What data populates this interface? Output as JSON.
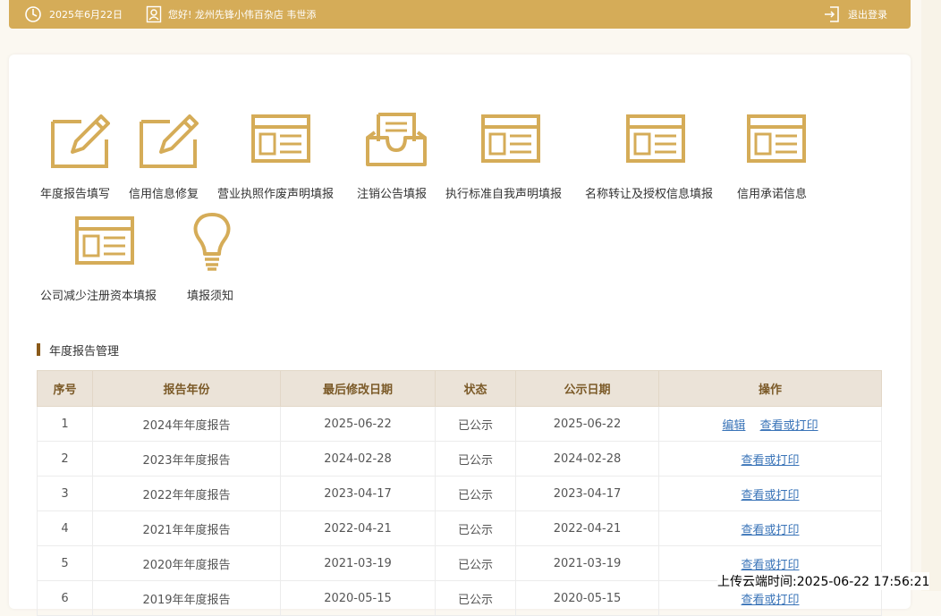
{
  "topbar": {
    "date": "2025年6月22日",
    "greeting": "您好! 龙州先锋小伟百杂店  韦世添",
    "logout": "退出登录"
  },
  "tiles": [
    {
      "label": "年度报告填写",
      "icon": "edit-icon"
    },
    {
      "label": "信用信息修复",
      "icon": "edit-icon"
    },
    {
      "label": "营业执照作废声明填报",
      "icon": "form-icon"
    },
    {
      "label": "注销公告填报",
      "icon": "inbox-icon"
    },
    {
      "label": "执行标准自我声明填报",
      "icon": "form-icon"
    },
    {
      "label": "名称转让及授权信息填报",
      "icon": "form-icon"
    },
    {
      "label": "信用承诺信息",
      "icon": "form-icon"
    },
    {
      "label": "公司减少注册资本填报",
      "icon": "form-icon"
    },
    {
      "label": "填报须知",
      "icon": "lightbulb-icon"
    }
  ],
  "section": {
    "title": "年度报告管理"
  },
  "table": {
    "headers": [
      "序号",
      "报告年份",
      "最后修改日期",
      "状态",
      "公示日期",
      "操作"
    ],
    "rows": [
      {
        "no": "1",
        "year": "2024年年度报告",
        "modified": "2025-06-22",
        "status": "已公示",
        "published": "2025-06-22",
        "actions": [
          "编辑",
          "查看或打印"
        ]
      },
      {
        "no": "2",
        "year": "2023年年度报告",
        "modified": "2024-02-28",
        "status": "已公示",
        "published": "2024-02-28",
        "actions": [
          "查看或打印"
        ]
      },
      {
        "no": "3",
        "year": "2022年年度报告",
        "modified": "2023-04-17",
        "status": "已公示",
        "published": "2023-04-17",
        "actions": [
          "查看或打印"
        ]
      },
      {
        "no": "4",
        "year": "2021年年度报告",
        "modified": "2022-04-21",
        "status": "已公示",
        "published": "2022-04-21",
        "actions": [
          "查看或打印"
        ]
      },
      {
        "no": "5",
        "year": "2020年年度报告",
        "modified": "2021-03-19",
        "status": "已公示",
        "published": "2021-03-19",
        "actions": [
          "查看或打印"
        ]
      },
      {
        "no": "6",
        "year": "2019年年度报告",
        "modified": "2020-05-15",
        "status": "已公示",
        "published": "2020-05-15",
        "actions": [
          "查看或打印"
        ]
      }
    ]
  },
  "overlay": {
    "upload_time": "上传云端时间:2025-06-22 17:56:21"
  },
  "colors": {
    "accent": "#d5ac58",
    "header_bg": "#ebe3d8",
    "link": "#3a74b8",
    "section_bar": "#8a5a1a"
  }
}
